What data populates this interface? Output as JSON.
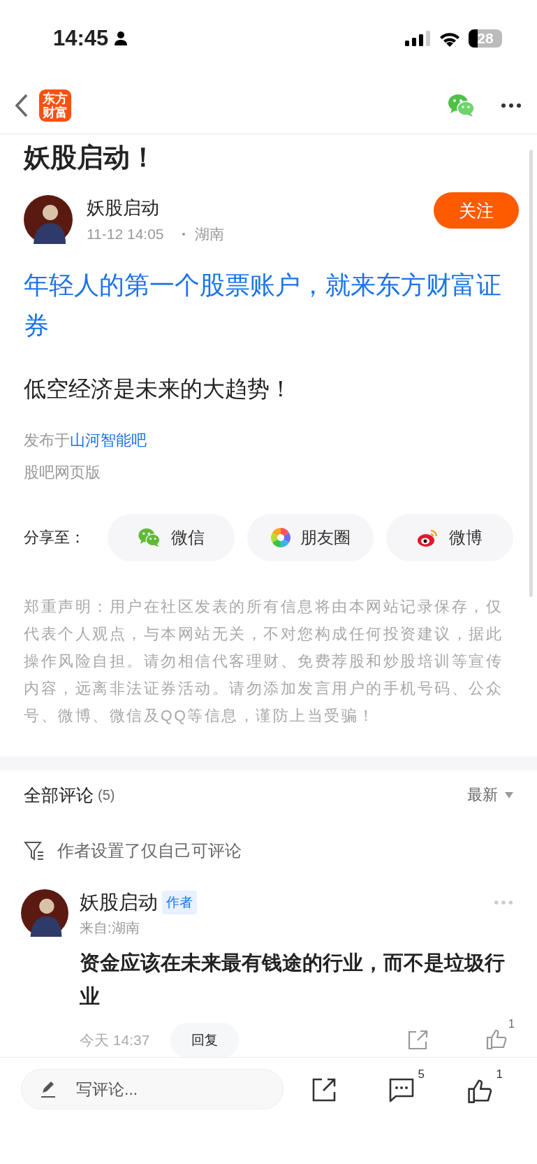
{
  "status_bar": {
    "time": "14:45",
    "battery": "28"
  },
  "nav": {
    "logo": [
      "东方",
      "财富"
    ]
  },
  "article": {
    "title": "妖股启动！",
    "author": {
      "name": "妖股启动",
      "date": "11-12 14:05",
      "location": "湖南"
    },
    "follow_button": "关注",
    "ad_link": "年轻人的第一个股票账户，就来东方财富证券",
    "body": "低空经济是未来的大趋势！",
    "source": {
      "prefix": "发布于",
      "link": "山河智能吧"
    },
    "via": "股吧网页版"
  },
  "share": {
    "label": "分享至：",
    "targets": [
      {
        "kind": "wechat",
        "label": "微信"
      },
      {
        "kind": "moments",
        "label": "朋友圈"
      },
      {
        "kind": "weibo",
        "label": "微博"
      }
    ]
  },
  "disclaimer": "郑重声明：用户在社区发表的所有信息将由本网站记录保存，仅代表个人观点，与本网站无关，不对您构成任何投资建议，据此操作风险自担。请勿相信代客理财、免费荐股和炒股培训等宣传内容，远离非法证券活动。请勿添加发言用户的手机号码、公众号、微博、微信及QQ等信息，谨防上当受骗！",
  "comments": {
    "header": "全部评论",
    "count": "(5)",
    "sort": "最新",
    "notice": "作者设置了仅自己可评论",
    "items": [
      {
        "author": "妖股启动",
        "badge": "作者",
        "location": "来自:湖南",
        "text": "资金应该在未来最有钱途的行业，而不是垃圾行业",
        "time": "今天 14:37",
        "reply": "回复",
        "like_count": "1"
      }
    ]
  },
  "bottom_bar": {
    "placeholder": "写评论...",
    "comment_count": "5",
    "like_count": "1"
  }
}
